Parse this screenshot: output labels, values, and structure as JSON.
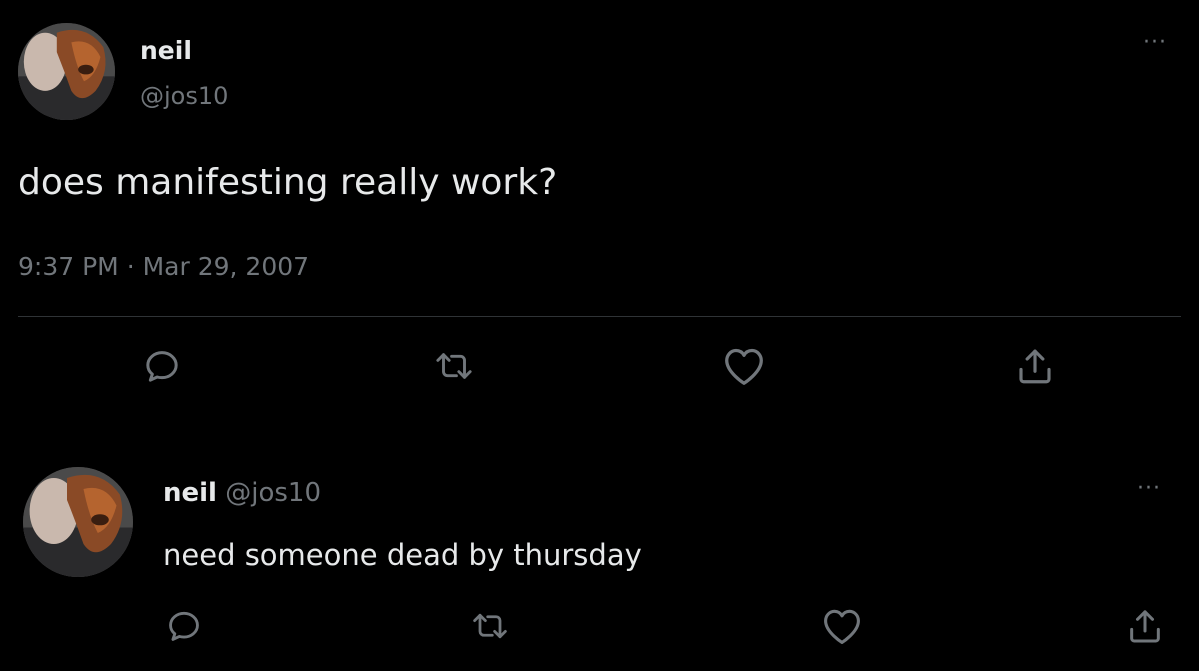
{
  "main_tweet": {
    "author_name": "neil",
    "author_handle": "@jos10",
    "text": "does manifesting really work?",
    "time": "9:37 PM",
    "separator": "·",
    "date": "Mar 29, 2007",
    "more_label": "···",
    "actions": [
      "reply-icon",
      "retweet-icon",
      "like-icon",
      "share-icon"
    ]
  },
  "reply_tweet": {
    "author_name": "neil",
    "author_handle": "@jos10",
    "text": "need someone dead by thursday",
    "more_label": "···",
    "actions": [
      "reply-icon",
      "retweet-icon",
      "like-icon",
      "share-icon"
    ]
  },
  "colors": {
    "background": "#000000",
    "primary_text": "#e7e9ea",
    "secondary_text": "#71767b",
    "divider": "#2f3336"
  }
}
